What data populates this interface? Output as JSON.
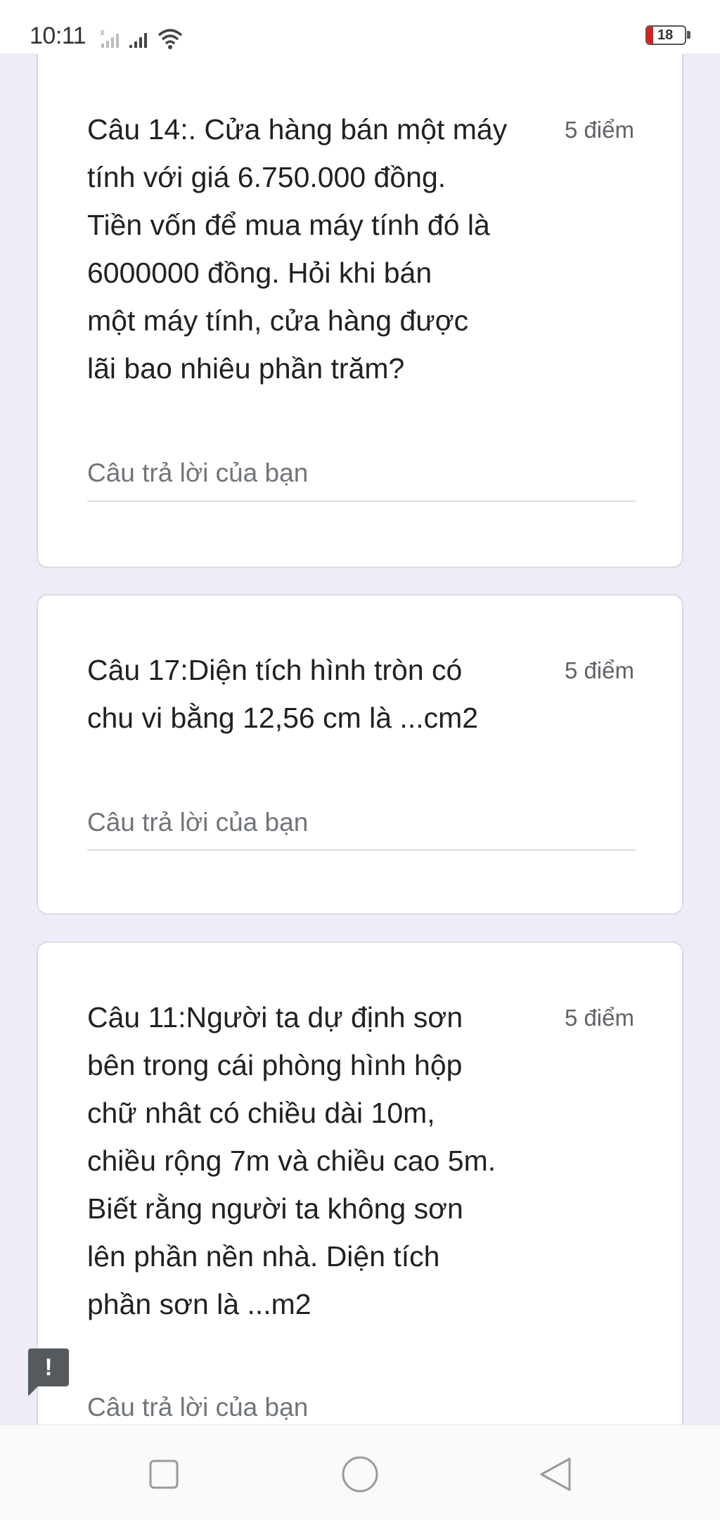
{
  "status_bar": {
    "time": "10:11",
    "battery_level": "18",
    "icons": [
      "sim-signal-icon",
      "signal-icon",
      "wifi-icon",
      "battery-icon"
    ]
  },
  "questions": [
    {
      "lines": [
        "Câu 14:. Cửa hàng bán một máy",
        "tính với giá 6.750.000 đồng.",
        "Tiền vốn để mua máy tính đó là",
        "6000000 đồng. Hỏi khi bán",
        "một máy tính, cửa hàng được",
        "lãi bao nhiêu phần trăm?"
      ],
      "points": "5 điểm",
      "answer_placeholder": "Câu trả lời của bạn"
    },
    {
      "lines": [
        "Câu 17:Diện tích hình tròn có",
        "chu vi bằng 12,56 cm là ...cm2"
      ],
      "points": "5 điểm",
      "answer_placeholder": "Câu trả lời của bạn"
    },
    {
      "lines": [
        "Câu 11:Người ta dự định sơn",
        "bên trong cái phòng hình hộp",
        "chữ nhât có chiều dài 10m,",
        "chiều rộng 7m và chiều cao 5m.",
        "Biết rằng người ta không sơn",
        "lên phần nền nhà. Diện tích",
        "phần sơn là ...m2"
      ],
      "points": "5 điểm",
      "answer_placeholder": "Câu trả lời của bạn"
    }
  ],
  "feedback_button": {
    "icon": "report-feedback-icon",
    "label": "!"
  },
  "nav_bar": {
    "buttons": [
      "recents-square-icon",
      "home-circle-icon",
      "back-triangle-icon"
    ]
  }
}
